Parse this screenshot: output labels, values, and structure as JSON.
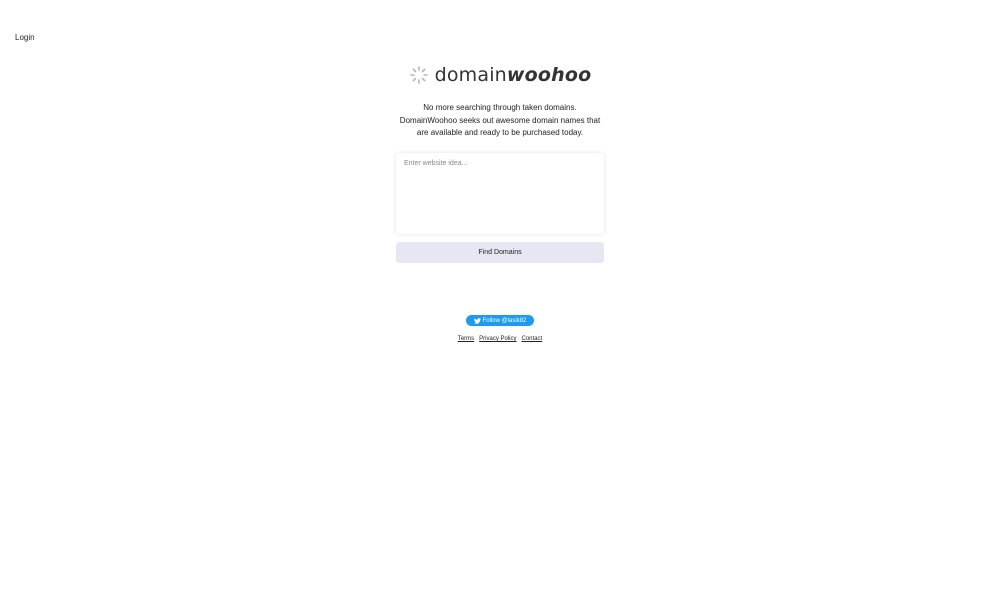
{
  "header": {
    "login_label": "Login"
  },
  "logo": {
    "icon": "spinner-icon",
    "text_plain": "domain",
    "text_emphasis": "woohoo"
  },
  "tagline": "No more searching through taken domains. DomainWoohoo seeks out awesome domain names that are available and ready to be purchased today.",
  "search": {
    "value": "",
    "placeholder": "Enter website idea..."
  },
  "find_button_label": "Find Domains",
  "twitter": {
    "icon": "twitter-bird-icon",
    "label": "Follow @lasik82",
    "color": "#1d9bf0"
  },
  "footer": {
    "links": [
      "Terms",
      "Privacy Policy",
      "Contact"
    ]
  },
  "colors": {
    "button_bg": "#e7e7f3",
    "text": "#222222"
  }
}
